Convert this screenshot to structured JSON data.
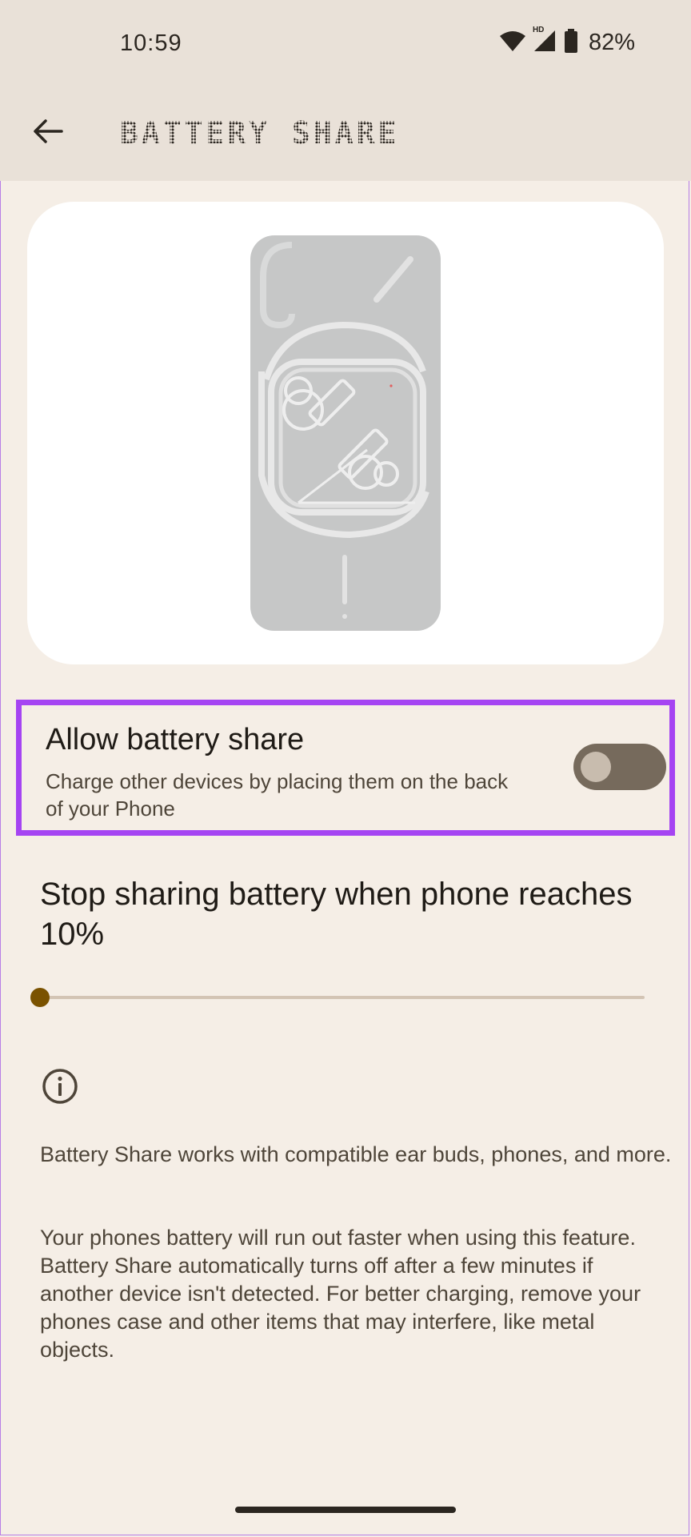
{
  "status_bar": {
    "time": "10:59",
    "network_badge": "HD",
    "battery_percent": "82%",
    "icons": [
      "wifi-icon",
      "cell-signal-icon",
      "battery-icon"
    ]
  },
  "header": {
    "back_icon": "arrow-left-icon",
    "title": "BATTERY SHARE"
  },
  "illustration": {
    "icon": "phone-back-with-earbuds-illustration"
  },
  "battery_share_toggle": {
    "title": "Allow battery share",
    "summary": "Charge other devices by placing them on the back of your Phone",
    "enabled": false
  },
  "threshold": {
    "title": "Stop sharing battery when phone reaches 10%",
    "value_percent": 10,
    "min_percent": 10,
    "max_percent": 90
  },
  "info": {
    "icon": "info-circle-icon",
    "paragraph_1": "Battery Share works with compatible ear buds, phones, and more.",
    "paragraph_2": "Your phones battery will run out faster when using this feature. Battery Share automatically turns off after a few minutes if another device isn't detected. For better charging, remove your phones case and other items that may interfere, like metal objects."
  },
  "colors": {
    "background": "#f5eee6",
    "header_background": "#e9e1d8",
    "highlight_border": "#a544f2",
    "switch_track_off": "#766a5c",
    "slider_accent": "#7a5200"
  }
}
